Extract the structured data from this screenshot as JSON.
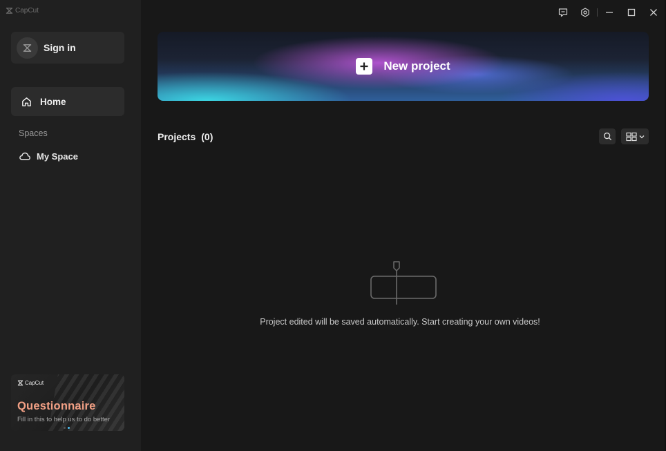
{
  "app": {
    "brand_name": "CapCut"
  },
  "sidebar": {
    "sign_in_label": "Sign in",
    "home_label": "Home",
    "spaces_heading": "Spaces",
    "my_space_label": "My Space",
    "promo": {
      "brand_name": "CapCut",
      "title": "Questionnaire",
      "subtitle": "Fill in this to help us to do better"
    }
  },
  "titlebar": {
    "icons": [
      "feedback-icon",
      "settings-icon",
      "minimize-icon",
      "maximize-icon",
      "close-icon"
    ]
  },
  "main": {
    "new_project_label": "New project",
    "projects_title": "Projects",
    "projects_count": "(0)",
    "empty_message": "Project edited will be saved automatically. Start creating your own videos!"
  },
  "colors": {
    "background": "#181818",
    "sidebar": "#202020",
    "promo_title": "#f2a085",
    "accent_dot": "#4fc3f7"
  }
}
